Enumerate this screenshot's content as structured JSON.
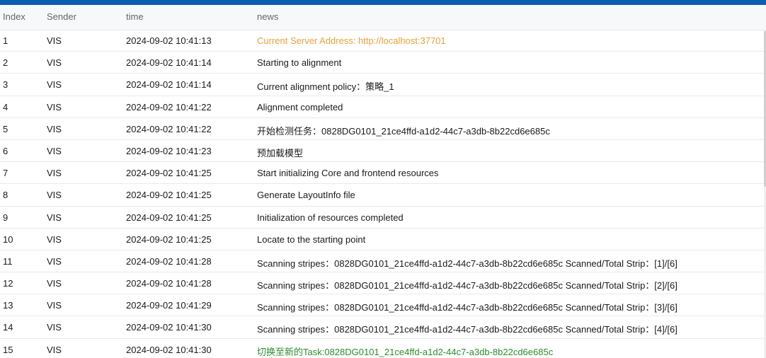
{
  "columns": {
    "index": "Index",
    "sender": "Sender",
    "time": "time",
    "news": "news"
  },
  "rows": [
    {
      "index": "1",
      "sender": "VIS",
      "time": "2024-09-02 10:41:13",
      "news": "Current Server Address: http://localhost:37701",
      "news_color": "orange"
    },
    {
      "index": "2",
      "sender": "VIS",
      "time": "2024-09-02 10:41:14",
      "news": "Starting to  alignment",
      "news_color": "default"
    },
    {
      "index": "3",
      "sender": "VIS",
      "time": "2024-09-02 10:41:14",
      "news": "Current alignment policy：策略_1",
      "news_color": "default"
    },
    {
      "index": "4",
      "sender": "VIS",
      "time": "2024-09-02 10:41:22",
      "news": "Alignment completed",
      "news_color": "default"
    },
    {
      "index": "5",
      "sender": "VIS",
      "time": "2024-09-02 10:41:22",
      "news": "开始检测任务：0828DG0101_21ce4ffd-a1d2-44c7-a3db-8b22cd6e685c",
      "news_color": "default"
    },
    {
      "index": "6",
      "sender": "VIS",
      "time": "2024-09-02 10:41:23",
      "news": "预加载模型",
      "news_color": "default"
    },
    {
      "index": "7",
      "sender": "VIS",
      "time": "2024-09-02 10:41:25",
      "news": "Start initializing Core and frontend resources",
      "news_color": "default"
    },
    {
      "index": "8",
      "sender": "VIS",
      "time": "2024-09-02 10:41:25",
      "news": "Generate LayoutInfo file",
      "news_color": "default"
    },
    {
      "index": "9",
      "sender": "VIS",
      "time": "2024-09-02 10:41:25",
      "news": "Initialization of resources completed",
      "news_color": "default"
    },
    {
      "index": "10",
      "sender": "VIS",
      "time": "2024-09-02 10:41:25",
      "news": "Locate to the starting point",
      "news_color": "default"
    },
    {
      "index": "11",
      "sender": "VIS",
      "time": "2024-09-02 10:41:28",
      "news": "Scanning stripes：0828DG0101_21ce4ffd-a1d2-44c7-a3db-8b22cd6e685c  Scanned/Total Strip：[1]/[6]",
      "news_color": "default"
    },
    {
      "index": "12",
      "sender": "VIS",
      "time": "2024-09-02 10:41:28",
      "news": "Scanning stripes：0828DG0101_21ce4ffd-a1d2-44c7-a3db-8b22cd6e685c  Scanned/Total Strip：[2]/[6]",
      "news_color": "default"
    },
    {
      "index": "13",
      "sender": "VIS",
      "time": "2024-09-02 10:41:29",
      "news": "Scanning stripes：0828DG0101_21ce4ffd-a1d2-44c7-a3db-8b22cd6e685c  Scanned/Total Strip：[3]/[6]",
      "news_color": "default"
    },
    {
      "index": "14",
      "sender": "VIS",
      "time": "2024-09-02 10:41:30",
      "news": "Scanning stripes：0828DG0101_21ce4ffd-a1d2-44c7-a3db-8b22cd6e685c  Scanned/Total Strip：[4]/[6]",
      "news_color": "default"
    },
    {
      "index": "15",
      "sender": "VIS",
      "time": "2024-09-02 10:41:30",
      "news": "切换至新的Task:0828DG0101_21ce4ffd-a1d2-44c7-a3db-8b22cd6e685c",
      "news_color": "green"
    }
  ],
  "colors": {
    "topbar": "#0b5fb3",
    "orange": "#e8a23a",
    "green": "#2e8b2e"
  }
}
